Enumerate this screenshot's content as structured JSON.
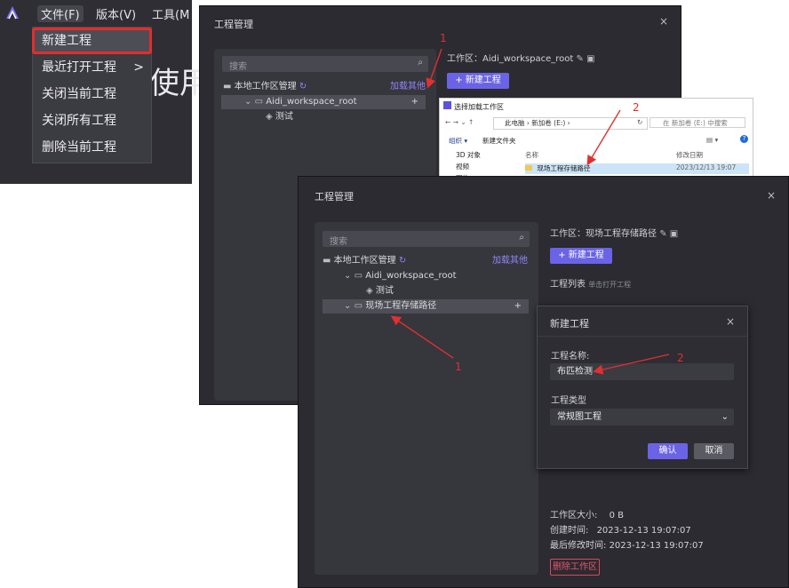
{
  "colors": {
    "accent": "#6b63e6",
    "link": "#8f86f6",
    "annotation": "#e0302f",
    "highlight_border": "#e32d2d"
  },
  "panelA": {
    "menubar": {
      "file": "文件(F)",
      "version": "版本(V)",
      "tools": "工具(M"
    },
    "big_text": "使用",
    "menu_items": [
      "新建工程",
      "最近打开工程",
      "关闭当前工程",
      "关闭所有工程",
      "删除当前工程"
    ],
    "submenu_arrow": ">"
  },
  "dialog1": {
    "title": "工程管理",
    "close": "×",
    "search_placeholder": "搜索",
    "local_label": "本地工作区管理",
    "load_other": "加载其他",
    "workspace_root": "Aidi_workspace_root",
    "project_test": "测试",
    "plus": "+",
    "workspace_label": "工作区：Aidi_workspace_root",
    "new_project_btn": "+ 新建工程"
  },
  "filepicker": {
    "title": "选择加载工作区",
    "address": "此电脑 › 新加卷 (E:) ›",
    "search_placeholder": "在 新加卷 (E:) 中搜索",
    "organize": "组织 ▾",
    "new_folder": "新建文件夹",
    "col_name": "名称",
    "col_modified": "修改日期",
    "nav_items": [
      "3D 对象",
      "视频",
      "图片"
    ],
    "folder_name": "现场工程存储路径",
    "folder_date": "2023/12/13 19:07"
  },
  "dialog2": {
    "title": "工程管理",
    "close": "×",
    "search_placeholder": "搜索",
    "local_label": "本地工作区管理",
    "load_other": "加载其他",
    "workspace_root": "Aidi_workspace_root",
    "project_test": "测试",
    "field_path": "现场工程存储路径",
    "plus": "+",
    "workspace_label": "工作区：现场工程存储路径",
    "new_project_btn": "+ 新建工程",
    "project_list": "工程列表",
    "project_list_hint": "单击打开工程",
    "workspace_size_label": "工作区大小:",
    "workspace_size": "0 B",
    "created_label": "创建时间:",
    "created": "2023-12-13 19:07:07",
    "modified_label": "最后修改时间:",
    "modified": "2023-12-13 19:07:07",
    "delete_btn": "删除工作区"
  },
  "new_project_modal": {
    "title": "新建工程",
    "close": "×",
    "name_label": "工程名称:",
    "name_value": "布匹检测",
    "type_label": "工程类型",
    "type_value": "常规图工程",
    "confirm": "确认",
    "cancel": "取消"
  },
  "annotations": {
    "n1a": "1",
    "n2a": "2",
    "n1b": "1",
    "n2b": "2"
  }
}
